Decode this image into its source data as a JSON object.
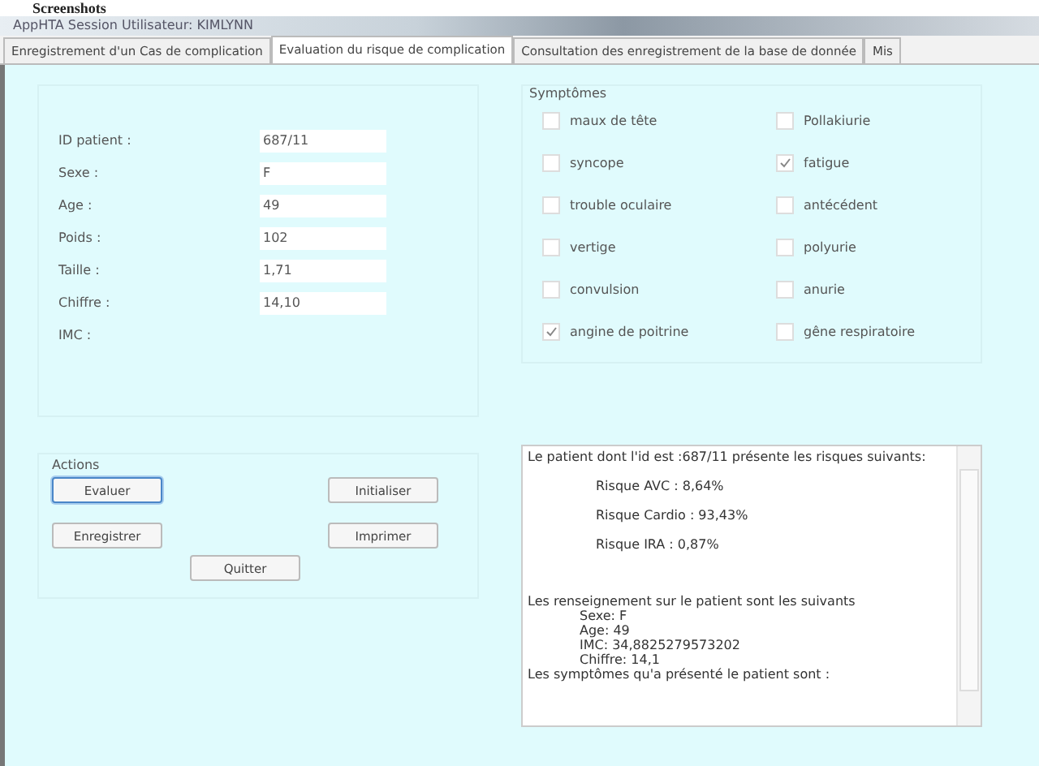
{
  "doc_heading": "Screenshots",
  "window": {
    "title": "AppHTA   Session Utilisateur: KIMLYNN"
  },
  "tabs": [
    {
      "label": "Enregistrement d'un Cas de complication",
      "selected": false
    },
    {
      "label": "Evaluation du risque de complication",
      "selected": true
    },
    {
      "label": "Consultation des enregistrement de la base de donnée",
      "selected": false
    },
    {
      "label": "Mis",
      "selected": false
    }
  ],
  "patient": {
    "fields": [
      {
        "label": "ID patient :",
        "value": "687/11"
      },
      {
        "label": "Sexe :",
        "value": "F"
      },
      {
        "label": "Age :",
        "value": "49"
      },
      {
        "label": "Poids :",
        "value": "102"
      },
      {
        "label": "Taille :",
        "value": "1,71"
      },
      {
        "label": "Chiffre :",
        "value": "14,10"
      }
    ],
    "imc_label": "IMC :"
  },
  "actions": {
    "title": "Actions",
    "buttons": [
      {
        "label": "Evaluer",
        "focused": true
      },
      {
        "label": "Initialiser",
        "focused": false
      },
      {
        "label": "Enregistrer",
        "focused": false
      },
      {
        "label": "Imprimer",
        "focused": false
      },
      {
        "label": "Quitter",
        "focused": false
      }
    ]
  },
  "symptoms": {
    "title": "Symptômes",
    "items": [
      {
        "label": "maux de tête",
        "checked": false
      },
      {
        "label": "Pollakiurie",
        "checked": false
      },
      {
        "label": "syncope",
        "checked": false
      },
      {
        "label": "fatigue",
        "checked": true
      },
      {
        "label": "trouble oculaire",
        "checked": false
      },
      {
        "label": "antécédent",
        "checked": false
      },
      {
        "label": "vertige",
        "checked": false
      },
      {
        "label": "polyurie",
        "checked": false
      },
      {
        "label": "convulsion",
        "checked": false
      },
      {
        "label": "anurie",
        "checked": false
      },
      {
        "label": "angine de poitrine",
        "checked": true
      },
      {
        "label": "gêne respiratoire",
        "checked": false
      }
    ]
  },
  "result": {
    "lines": [
      {
        "kind": "para",
        "text": "Le patient dont l'id est :687/11    présente les risques suivants:"
      },
      {
        "kind": "risk",
        "text": "Risque AVC :   8,64%"
      },
      {
        "kind": "risk",
        "text": "Risque Cardio :   93,43%"
      },
      {
        "kind": "risk",
        "text": "Risque IRA :    0,87%"
      },
      {
        "kind": "gap",
        "text": "Les renseignement sur le patient sont les suivants"
      },
      {
        "kind": "detail",
        "text": "Sexe: F"
      },
      {
        "kind": "detail",
        "text": "Age: 49"
      },
      {
        "kind": "detail",
        "text": "IMC: 34,8825279573202"
      },
      {
        "kind": "detail",
        "text": "Chiffre: 14,1"
      },
      {
        "kind": "para",
        "text": "Les symptômes qu'a présenté le patient sont :"
      }
    ]
  }
}
